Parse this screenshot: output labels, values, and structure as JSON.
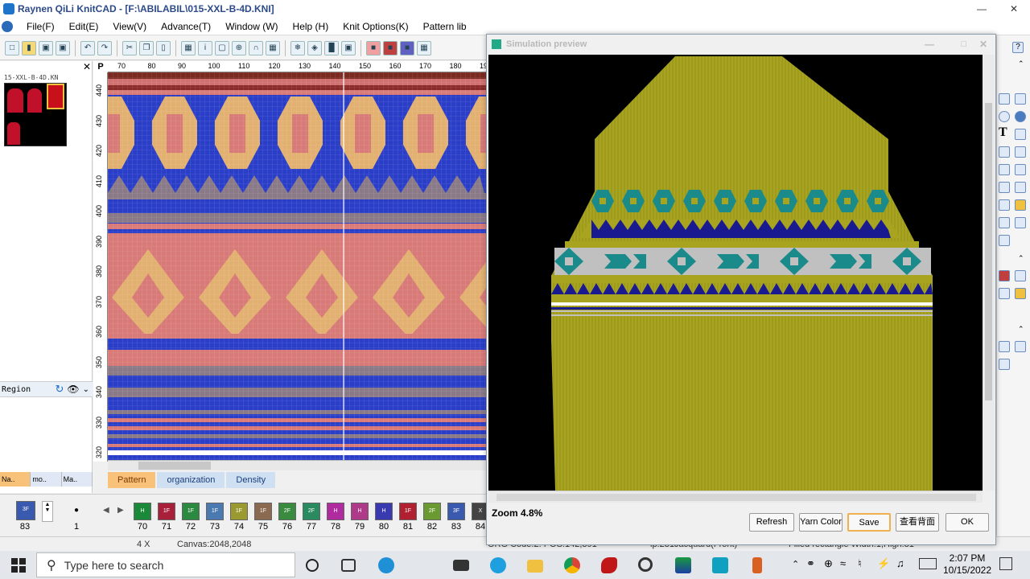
{
  "window": {
    "title": "Raynen QiLi KnitCAD - [F:\\ABILABIL\\015-XXL-B-4D.KNI]"
  },
  "menu": [
    "File(F)",
    "Edit(E)",
    "View(V)",
    "Advance(T)",
    "Window (W)",
    "Help (H)",
    "Knit Options(K)",
    "Pattern lib"
  ],
  "left_panel": {
    "file_label": "15-XXL-B-4D.KN",
    "region_label": "Region",
    "tabs": [
      "Na..",
      "mo..",
      "Ma.."
    ]
  },
  "ruler": {
    "corner": "P",
    "top": [
      "70",
      "80",
      "90",
      "100",
      "110",
      "120",
      "130",
      "140",
      "150",
      "160",
      "170",
      "180",
      "190"
    ],
    "left": [
      "440",
      "430",
      "420",
      "410",
      "400",
      "390",
      "380",
      "370",
      "360",
      "350",
      "340",
      "330",
      "320"
    ]
  },
  "pattern_tabs": [
    "Pattern",
    "organization",
    "Density"
  ],
  "bottom_strip": {
    "current": {
      "value": "83"
    },
    "stepper": {
      "value": "1"
    },
    "swatches": [
      {
        "num": "70",
        "label": "H",
        "color": "#1a8a3a"
      },
      {
        "num": "71",
        "label": "1F",
        "color": "#a8203a"
      },
      {
        "num": "72",
        "label": "1F",
        "color": "#2c8a40"
      },
      {
        "num": "73",
        "label": "1F",
        "color": "#4a7ab0"
      },
      {
        "num": "74",
        "label": "1F",
        "color": "#9a9a30"
      },
      {
        "num": "75",
        "label": "1F",
        "color": "#8a6a50"
      },
      {
        "num": "76",
        "label": "2F",
        "color": "#3a8a40"
      },
      {
        "num": "77",
        "label": "2F",
        "color": "#2a8a60"
      },
      {
        "num": "78",
        "label": "H",
        "color": "#b02aa0"
      },
      {
        "num": "79",
        "label": "H",
        "color": "#b03a8a"
      },
      {
        "num": "80",
        "label": "H",
        "color": "#3a3ab0"
      },
      {
        "num": "81",
        "label": "1F",
        "color": "#b02030"
      },
      {
        "num": "82",
        "label": "2F",
        "color": "#6a9a30"
      },
      {
        "num": "83",
        "label": "3F",
        "color": "#3a5ab0"
      },
      {
        "num": "84",
        "label": "X",
        "color": "#444444"
      }
    ]
  },
  "status": {
    "zoom": "4 X",
    "canvas": "Canvas:2048,2048",
    "org": "ORG Code:2: POS:142,391",
    "info": "lp:231Jacquard(Front)",
    "shape": "Filled rectangle  Width:1,High:31"
  },
  "sim": {
    "title": "Simulation preview",
    "zoom": "Zoom 4.8%",
    "buttons": [
      "Refresh",
      "Yarn Color",
      "Save",
      "查看背面",
      "OK"
    ]
  },
  "taskbar": {
    "search_placeholder": "Type here to search",
    "time": "2:07 PM",
    "date": "10/15/2022"
  },
  "colors": {
    "olive": "#a8a420",
    "blue": "#2a3ec8",
    "salmon": "#d87a78",
    "gold": "#e2b070",
    "gray": "#8a7a88",
    "teal": "#1a8a8a",
    "navy": "#1a1a90",
    "maroon": "#7a2a20"
  }
}
